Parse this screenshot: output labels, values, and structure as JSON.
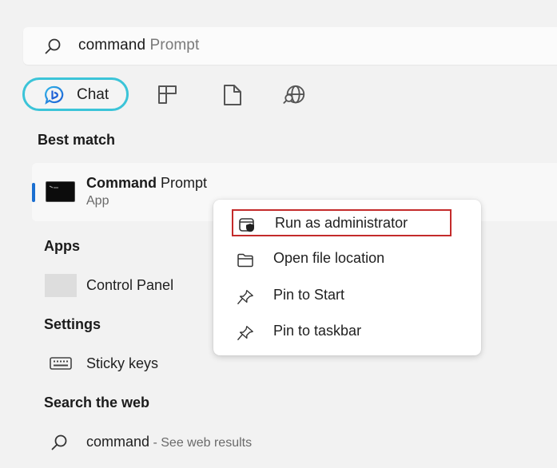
{
  "search": {
    "typed": "command",
    "suggestion": " Prompt",
    "icon": "search-icon"
  },
  "filters": {
    "chat_label": "Chat",
    "chat_accent": "#3bc4d8",
    "items": [
      {
        "name": "apps-filter",
        "icon": "apps-grid-icon"
      },
      {
        "name": "documents-filter",
        "icon": "document-icon"
      },
      {
        "name": "web-filter",
        "icon": "globe-search-icon"
      }
    ]
  },
  "best_match": {
    "heading": "Best match",
    "title_bold": "Command",
    "title_rest": " Prompt",
    "subtitle": "App",
    "accent": "#1a6fd1"
  },
  "context_menu": {
    "highlight_color": "#c42b2b",
    "items": [
      {
        "label": "Run as administrator",
        "icon": "shield-window-icon",
        "highlighted": true
      },
      {
        "label": "Open file location",
        "icon": "folder-icon"
      },
      {
        "label": "Pin to Start",
        "icon": "pin-icon"
      },
      {
        "label": "Pin to taskbar",
        "icon": "pin-icon"
      }
    ]
  },
  "apps": {
    "heading": "Apps",
    "items": [
      {
        "label": "Control Panel"
      }
    ]
  },
  "settings": {
    "heading": "Settings",
    "items": [
      {
        "label": "Sticky keys",
        "icon": "keyboard-icon"
      }
    ]
  },
  "web": {
    "heading": "Search the web",
    "query": "command",
    "suffix": " - See web results"
  }
}
